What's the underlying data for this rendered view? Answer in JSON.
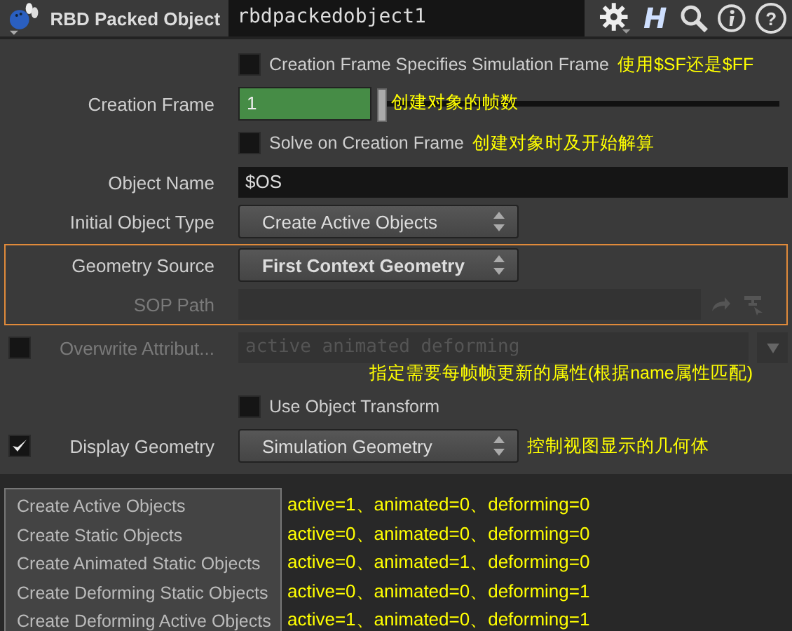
{
  "header": {
    "node_type": "RBD Packed Object",
    "node_name": "rbdpackedobject1",
    "hda_glyph": "H",
    "help_glyph": "?"
  },
  "parameters": [
    {
      "kind": "toggle",
      "label": "Creation Frame Specifies Simulation Frame",
      "checked": false,
      "note": "使用$SF还是$FF"
    },
    {
      "kind": "slider",
      "label": "Creation Frame",
      "value": "1",
      "level": 0,
      "note": "创建对象的帧数"
    },
    {
      "kind": "toggle",
      "label": "Solve on Creation Frame",
      "checked": false,
      "note": "创建对象时及开始解算"
    },
    {
      "kind": "text",
      "label": "Object Name",
      "value": "$OS"
    },
    {
      "kind": "menu",
      "label": "Initial Object Type",
      "value": "Create Active Objects"
    },
    {
      "kind": "group",
      "highlighted": true,
      "children": [
        {
          "kind": "menu",
          "label": "Geometry Source",
          "value": "First Context Geometry",
          "bold": true
        },
        {
          "kind": "path",
          "label": "SOP Path",
          "disabled": true
        }
      ]
    },
    {
      "kind": "attrib",
      "label": "Overwrite Attribut...",
      "checked": false,
      "disabled": true,
      "value": "active animated deforming",
      "note": "指定需要每帧帧更新的属性(根据name属性匹配)"
    },
    {
      "kind": "toggle",
      "label": "Use Object Transform",
      "checked": false
    },
    {
      "kind": "menu",
      "label": "Display Geometry",
      "checked": true,
      "value": "Simulation Geometry",
      "note": "控制视图显示的几何体"
    }
  ],
  "menu_popup": {
    "items": [
      {
        "label": "Create Active Objects",
        "note": "active=1、animated=0、deforming=0"
      },
      {
        "label": "Create Static Objects",
        "note": "active=0、animated=0、deforming=0"
      },
      {
        "label": "Create Animated Static Objects",
        "note": "active=0、animated=1、deforming=0"
      },
      {
        "label": "Create Deforming Static Objects",
        "note": "active=0、animated=0、deforming=1"
      },
      {
        "label": "Create Deforming Active Objects",
        "note": "active=1、animated=0、deforming=1"
      }
    ]
  }
}
